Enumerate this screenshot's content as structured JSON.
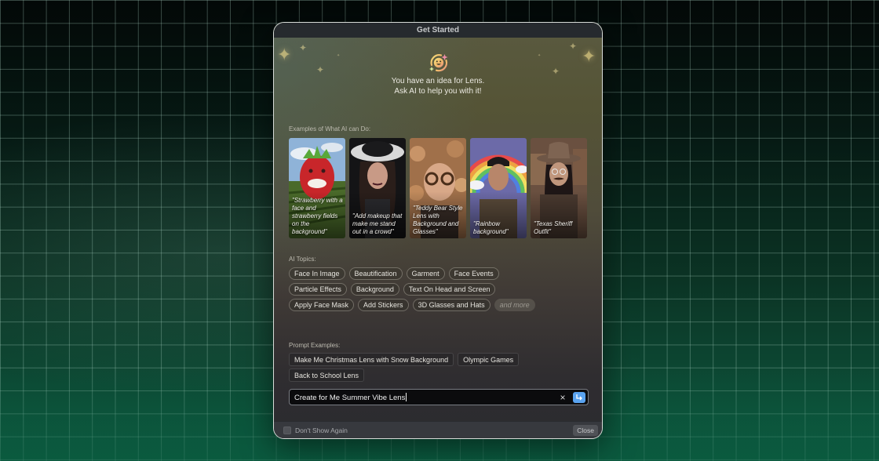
{
  "dialog": {
    "title": "Get Started",
    "hero_icon": "ai-smiley-sparkle-icon",
    "hero_line1": "You have an idea for Lens.",
    "hero_line2": "Ask AI to help you with it!"
  },
  "examples": {
    "label": "Examples of What AI can Do:",
    "cards": [
      {
        "caption": "\"Strawberry with a face and strawberry fields on the background\"",
        "subject": "strawberry with face in strawberry field"
      },
      {
        "caption": "\"Add makeup that make me stand out in a crowd\"",
        "subject": "woman in hat with makeup"
      },
      {
        "caption": "\"Teddy Bear Style Lens with Background and Glasses\"",
        "subject": "man with glasses among teddy bears"
      },
      {
        "caption": "\"Rainbow background\"",
        "subject": "man in front of rainbow sky"
      },
      {
        "caption": "\"Texas Sheriff Outfit\"",
        "subject": "woman in cowboy hat with mustache"
      }
    ]
  },
  "topics": {
    "label": "AI Topics:",
    "items": [
      "Face In Image",
      "Beautification",
      "Garment",
      "Face Events",
      "Particle Effects",
      "Background",
      "Text On Head and Screen",
      "Apply Face Mask",
      "Add Stickers",
      "3D Glasses and Hats"
    ],
    "more_label": "and more"
  },
  "prompts": {
    "label": "Prompt Examples:",
    "items": [
      "Make Me Christmas Lens with Snow Background",
      "Olympic Games",
      "Back to School Lens"
    ]
  },
  "input": {
    "value": "Create for Me Summer Vibe Lens",
    "clear_icon": "×",
    "submit_color": "#5aa3f0"
  },
  "footer": {
    "dont_show_label": "Don't Show Again",
    "dont_show_checked": false,
    "close_label": "Close"
  }
}
